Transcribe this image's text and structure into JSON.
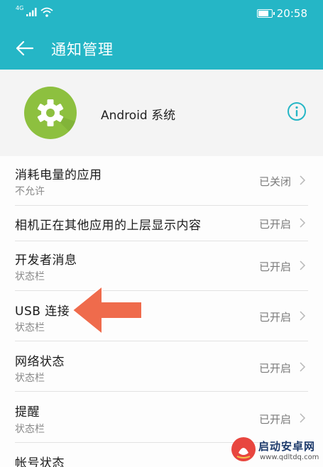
{
  "status_bar": {
    "network": "4G",
    "time": "20:58",
    "battery_level": 0.8
  },
  "app_bar": {
    "title": "通知管理",
    "back_icon": "arrow-left-icon"
  },
  "app_header": {
    "icon": "gear-icon",
    "name": "Android 系统",
    "info_icon": "info-icon"
  },
  "rows": [
    {
      "title": "消耗电量的应用",
      "subtitle": "不允许",
      "status": "已关闭"
    },
    {
      "title": "相机正在其他应用的上层显示内容",
      "subtitle": "",
      "status": "已开启"
    },
    {
      "title": "开发者消息",
      "subtitle": "状态栏",
      "status": "已开启"
    },
    {
      "title": "USB 连接",
      "subtitle": "状态栏",
      "status": "已开启"
    },
    {
      "title": "网络状态",
      "subtitle": "状态栏",
      "status": "已开启"
    },
    {
      "title": "提醒",
      "subtitle": "状态栏",
      "status": "已开启"
    },
    {
      "title": "帐号状态",
      "subtitle": "",
      "status": ""
    }
  ],
  "annotation": {
    "arrow_color": "#ef6b4c"
  },
  "watermark": {
    "title": "启动安卓网",
    "url": "www.qdltdq.com"
  },
  "colors": {
    "accent": "#25b6c6",
    "app_icon": "#8dc03f"
  }
}
